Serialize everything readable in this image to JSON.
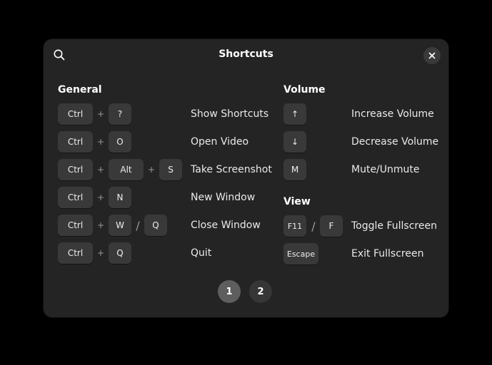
{
  "dialog": {
    "title": "Shortcuts",
    "search_icon": "search-icon",
    "close_icon": "close-icon"
  },
  "general": {
    "title": "General",
    "shortcuts": [
      {
        "keys": [
          "Ctrl",
          "+",
          "?"
        ],
        "label": "Show Shortcuts"
      },
      {
        "keys": [
          "Ctrl",
          "+",
          "O"
        ],
        "label": "Open Video"
      },
      {
        "keys": [
          "Ctrl",
          "+",
          "Alt",
          "+",
          "S"
        ],
        "label": "Take Screenshot"
      },
      {
        "keys": [
          "Ctrl",
          "+",
          "N"
        ],
        "label": "New Window"
      },
      {
        "keys": [
          "Ctrl",
          "+",
          "W",
          "/",
          "Q"
        ],
        "label": "Close Window"
      },
      {
        "keys": [
          "Ctrl",
          "+",
          "Q"
        ],
        "label": "Quit"
      }
    ]
  },
  "volume": {
    "title": "Volume",
    "shortcuts": [
      {
        "keys": [
          "↑"
        ],
        "label": "Increase Volume"
      },
      {
        "keys": [
          "↓"
        ],
        "label": "Decrease Volume"
      },
      {
        "keys": [
          "M"
        ],
        "label": "Mute/Unmute"
      }
    ]
  },
  "view": {
    "title": "View",
    "shortcuts": [
      {
        "keys": [
          "F11",
          "/",
          "F"
        ],
        "label": "Toggle Fullscreen"
      },
      {
        "keys": [
          "Escape"
        ],
        "label": "Exit Fullscreen"
      }
    ]
  },
  "pagination": {
    "pages": [
      "1",
      "2"
    ],
    "active": "1"
  }
}
